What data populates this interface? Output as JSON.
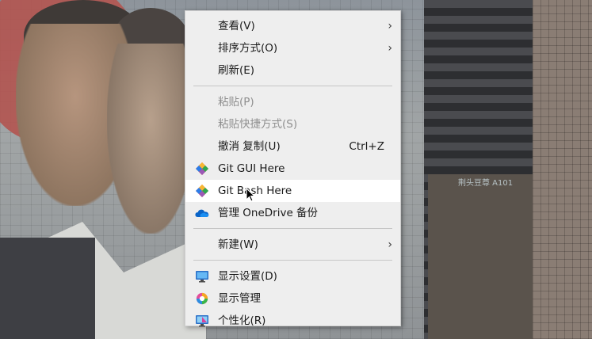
{
  "menu": {
    "items": [
      {
        "label": "查看(V)",
        "submenu": true
      },
      {
        "label": "排序方式(O)",
        "submenu": true
      },
      {
        "label": "刷新(E)"
      },
      {
        "label": "粘贴(P)",
        "disabled": true
      },
      {
        "label": "粘贴快捷方式(S)",
        "disabled": true
      },
      {
        "label": "撤消 复制(U)",
        "shortcut": "Ctrl+Z"
      },
      {
        "label": "Git GUI Here",
        "icon": "git-icon"
      },
      {
        "label": "Git Bash Here",
        "icon": "git-icon",
        "hovered": true
      },
      {
        "label": "管理 OneDrive 备份",
        "icon": "onedrive-cloud-icon"
      },
      {
        "label": "新建(W)",
        "submenu": true
      },
      {
        "label": "显示设置(D)",
        "icon": "display-monitor-icon"
      },
      {
        "label": "显示管理",
        "icon": "display-manager-icon"
      },
      {
        "label": "个性化(R)",
        "icon": "personalize-icon"
      }
    ],
    "submenu_arrow": "›"
  },
  "wallpaper": {
    "sign_text": "荆头豆尊 A101"
  },
  "colors": {
    "menu_bg": "#eeeeee",
    "hover_bg": "#ffffff",
    "disabled_text": "#8f8f8f",
    "onedrive_blue": "#0a64c8"
  }
}
